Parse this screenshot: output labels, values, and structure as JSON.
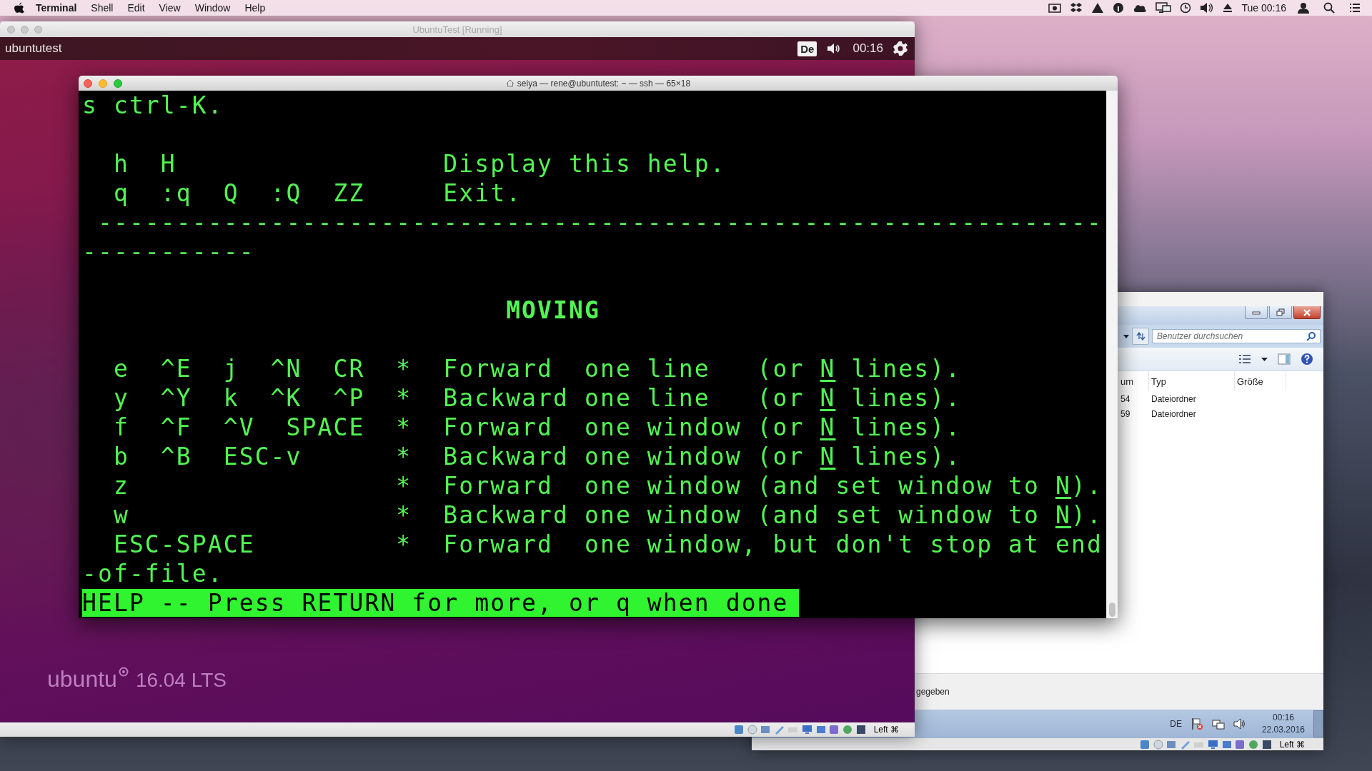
{
  "menu_bar": {
    "app": "Terminal",
    "menus": [
      "Shell",
      "Edit",
      "View",
      "Window",
      "Help"
    ],
    "clock": "Tue 00:16"
  },
  "windows_vm": {
    "explorer": {
      "search": {
        "placeholder": "Benutzer durchsuchen"
      },
      "columns": [
        "um",
        "Typ",
        "Größe"
      ],
      "rows": [
        [
          "54",
          "Dateiordner"
        ],
        [
          "59",
          "Dateiordner"
        ]
      ],
      "status_text": "gegeben"
    },
    "taskbar": {
      "language": "DE",
      "time": "00:16",
      "date": "22.03.2016"
    },
    "status_bar": {
      "host_key": "Left ⌘"
    }
  },
  "ubuntu_vm": {
    "title": "UbuntuTest [Running]",
    "panel": {
      "hostname": "ubuntutest",
      "keyboard": "De",
      "clock": "00:16"
    },
    "branding": {
      "name": "ubuntu",
      "version": "16.04 LTS"
    },
    "status_bar": {
      "host_key": "Left ⌘"
    }
  },
  "terminal": {
    "title": "seiya — rene@ubuntutest: ~ — ssh — 65×18",
    "lines": [
      {
        "kind": "text",
        "segments": [
          {
            "text": "s ctrl-K.",
            "underlined": false
          }
        ]
      },
      {
        "kind": "blank"
      },
      {
        "kind": "text",
        "segments": [
          {
            "text": "  h  H                 Display this help.",
            "underlined": false
          }
        ]
      },
      {
        "kind": "text",
        "segments": [
          {
            "text": "  q  :q  Q  :Q  ZZ     Exit.",
            "underlined": false
          }
        ]
      },
      {
        "kind": "text",
        "segments": [
          {
            "text": " ----------------------------------------------------------------",
            "underlined": false
          }
        ]
      },
      {
        "kind": "text",
        "segments": [
          {
            "text": "-----------",
            "underlined": false
          }
        ]
      },
      {
        "kind": "blank"
      },
      {
        "kind": "heading",
        "segments": [
          {
            "text": "                           MOVING",
            "underlined": false
          }
        ]
      },
      {
        "kind": "blank"
      },
      {
        "kind": "text",
        "segments": [
          {
            "text": "  e  ^E  j  ^N  CR  *  Forward  one line   (or ",
            "underlined": false
          },
          {
            "text": "N",
            "underlined": true
          },
          {
            "text": " lines).",
            "underlined": false
          }
        ]
      },
      {
        "kind": "text",
        "segments": [
          {
            "text": "  y  ^Y  k  ^K  ^P  *  Backward one line   (or ",
            "underlined": false
          },
          {
            "text": "N",
            "underlined": true
          },
          {
            "text": " lines).",
            "underlined": false
          }
        ]
      },
      {
        "kind": "text",
        "segments": [
          {
            "text": "  f  ^F  ^V  SPACE  *  Forward  one window (or ",
            "underlined": false
          },
          {
            "text": "N",
            "underlined": true
          },
          {
            "text": " lines).",
            "underlined": false
          }
        ]
      },
      {
        "kind": "text",
        "segments": [
          {
            "text": "  b  ^B  ESC-v      *  Backward one window (or ",
            "underlined": false
          },
          {
            "text": "N",
            "underlined": true
          },
          {
            "text": " lines).",
            "underlined": false
          }
        ]
      },
      {
        "kind": "text",
        "segments": [
          {
            "text": "  z                 *  Forward  one window (and set window to ",
            "underlined": false
          },
          {
            "text": "N",
            "underlined": true
          },
          {
            "text": ").",
            "underlined": false
          }
        ]
      },
      {
        "kind": "text",
        "segments": [
          {
            "text": "  w                 *  Backward one window (and set window to ",
            "underlined": false
          },
          {
            "text": "N",
            "underlined": true
          },
          {
            "text": ").",
            "underlined": false
          }
        ]
      },
      {
        "kind": "text",
        "segments": [
          {
            "text": "  ESC-SPACE         *  Forward  one window, but don't stop at end",
            "underlined": false
          }
        ]
      },
      {
        "kind": "text",
        "segments": [
          {
            "text": "-of-file.",
            "underlined": false
          }
        ]
      }
    ],
    "prompt": "HELP -- Press RETURN for more, or q when done"
  }
}
